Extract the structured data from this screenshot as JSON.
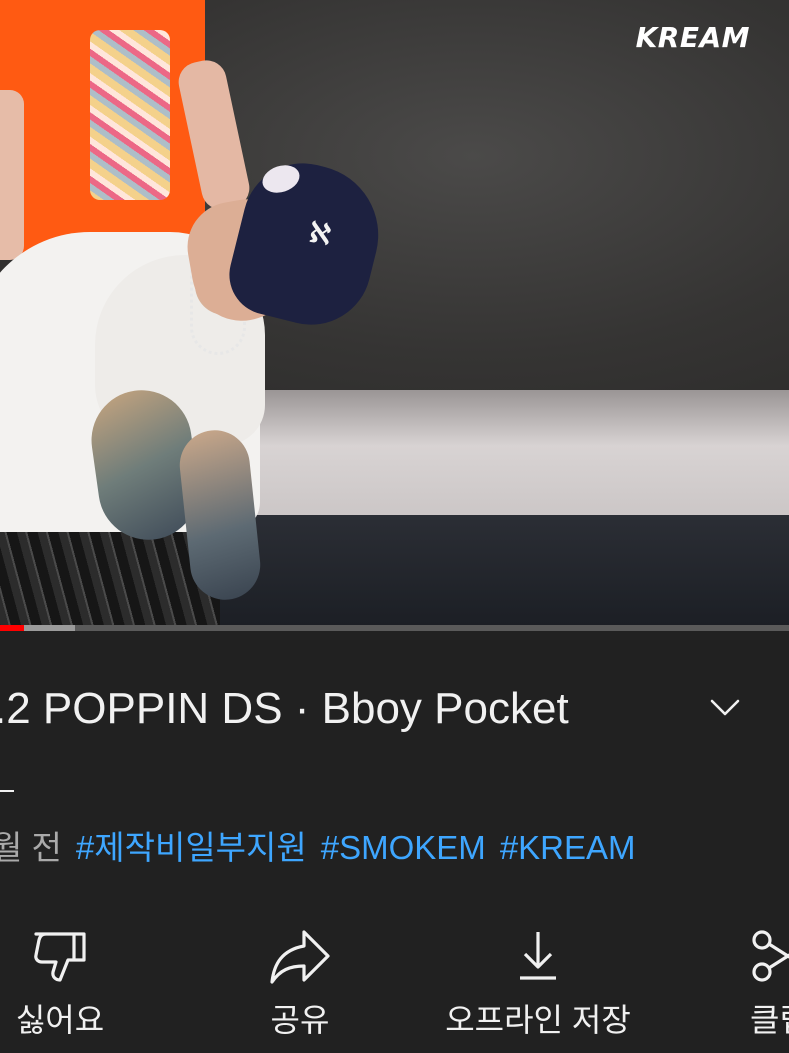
{
  "video": {
    "overlay_logo": "KREAM",
    "progress": {
      "played_fraction": 0.03,
      "buffered_fraction": 0.095
    }
  },
  "info": {
    "title": ".2 POPPIN DS · Bboy Pocket",
    "title_continuation": "-",
    "upload_time": "월 전",
    "hashtags": [
      "#제작비일부지원",
      "#SMOKEM",
      "#KREAM"
    ]
  },
  "actions": [
    {
      "label": "싫어요",
      "icon": "thumbs-down-icon"
    },
    {
      "label": "공유",
      "icon": "share-icon"
    },
    {
      "label": "오프라인 저장",
      "icon": "download-icon"
    },
    {
      "label": "클립",
      "icon": "scissors-icon"
    }
  ],
  "colors": {
    "background": "#212121",
    "text": "#f1f1f1",
    "secondary_text": "#aaaaaa",
    "hashtag": "#3ea6ff",
    "progress_played": "#ff0000"
  }
}
